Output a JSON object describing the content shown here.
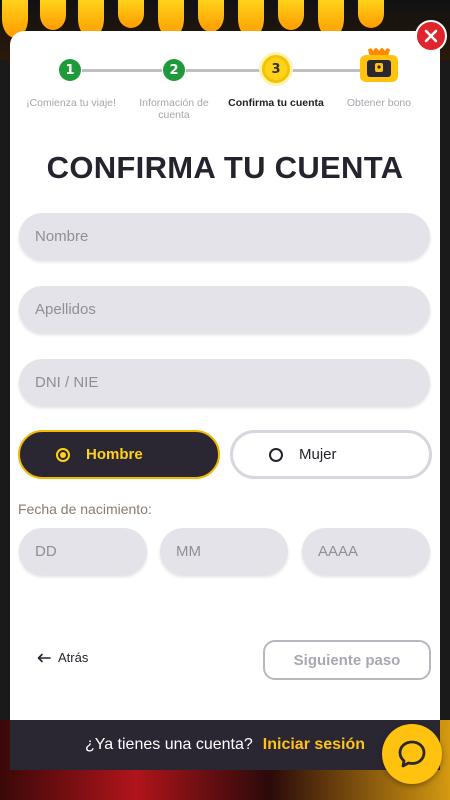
{
  "steps": [
    {
      "number": "1",
      "label": "¡Comienza tu viaje!",
      "state": "done"
    },
    {
      "number": "2",
      "label": "Información de cuenta",
      "state": "done"
    },
    {
      "number": "3",
      "label": "Confirma tu cuenta",
      "state": "active"
    },
    {
      "number": "",
      "label": "Obtener bono",
      "state": "bonus"
    }
  ],
  "title": "CONFIRMA TU CUENTA",
  "fields": {
    "first_name_placeholder": "Nombre",
    "last_name_placeholder": "Apellidos",
    "id_placeholder": "DNI / NIE"
  },
  "gender": {
    "male": "Hombre",
    "female": "Mujer",
    "selected": "Hombre"
  },
  "dob": {
    "label": "Fecha de nacimiento:",
    "day_placeholder": "DD",
    "month_placeholder": "MM",
    "year_placeholder": "AAAA"
  },
  "nav": {
    "back": "Atrás",
    "next": "Siguiente paso"
  },
  "footer": {
    "question": "¿Ya tienes una cuenta?",
    "login": "Iniciar sesión"
  },
  "colors": {
    "accent": "#ffc21a",
    "done": "#1f9a3a",
    "dark": "#2a2733",
    "close": "#e0242b"
  }
}
